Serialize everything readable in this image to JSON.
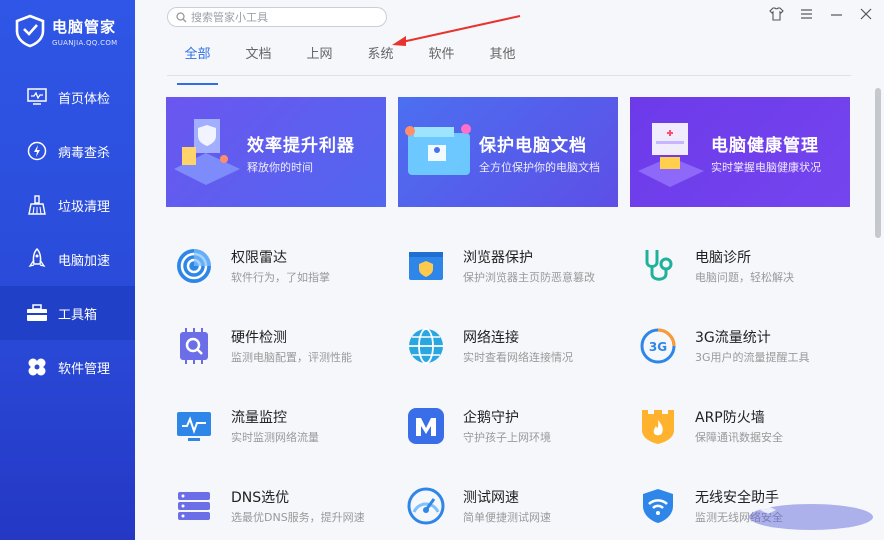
{
  "brand": {
    "title": "电脑管家",
    "subtitle": "GUANJIA.QQ.COM"
  },
  "nav": [
    {
      "label": "首页体检",
      "icon": "monitor-icon"
    },
    {
      "label": "病毒查杀",
      "icon": "lightning-shield-icon"
    },
    {
      "label": "垃圾清理",
      "icon": "broom-icon"
    },
    {
      "label": "电脑加速",
      "icon": "rocket-icon"
    },
    {
      "label": "工具箱",
      "icon": "toolbox-icon"
    },
    {
      "label": "软件管理",
      "icon": "apps-icon"
    }
  ],
  "search": {
    "placeholder": "搜索管家小工具"
  },
  "tabs": [
    "全部",
    "文档",
    "上网",
    "系统",
    "软件",
    "其他"
  ],
  "active_tab": "全部",
  "banners": [
    {
      "title": "效率提升利器",
      "subtitle": "释放你的时间"
    },
    {
      "title": "保护电脑文档",
      "subtitle": "全方位保护你的电脑文档"
    },
    {
      "title": "电脑健康管理",
      "subtitle": "实时掌握电脑健康状况"
    }
  ],
  "tools": [
    {
      "name": "权限雷达",
      "desc": "软件行为，了如指掌",
      "icon": "radar-icon"
    },
    {
      "name": "浏览器保护",
      "desc": "保护浏览器主页防恶意篡改",
      "icon": "browser-shield-icon"
    },
    {
      "name": "电脑诊所",
      "desc": "电脑问题，轻松解决",
      "icon": "stethoscope-icon"
    },
    {
      "name": "硬件检测",
      "desc": "监测电脑配置，评测性能",
      "icon": "chip-search-icon"
    },
    {
      "name": "网络连接",
      "desc": "实时查看网络连接情况",
      "icon": "globe-icon"
    },
    {
      "name": "3G流量统计",
      "desc": "3G用户的流量提醒工具",
      "icon": "3g-icon"
    },
    {
      "name": "流量监控",
      "desc": "实时监测网络流量",
      "icon": "traffic-monitor-icon"
    },
    {
      "name": "企鹅守护",
      "desc": "守护孩子上网环境",
      "icon": "penguin-guard-icon"
    },
    {
      "name": "ARP防火墙",
      "desc": "保障通讯数据安全",
      "icon": "firewall-icon"
    },
    {
      "name": "DNS选优",
      "desc": "选最优DNS服务，提升网速",
      "icon": "server-icon"
    },
    {
      "name": "测试网速",
      "desc": "简单便捷测试网速",
      "icon": "speedometer-icon"
    },
    {
      "name": "无线安全助手",
      "desc": "监测无线网络安全",
      "icon": "wifi-shield-icon"
    }
  ],
  "colors": {
    "sidebar": "#2f56e6",
    "accent": "#2f6ee8"
  }
}
